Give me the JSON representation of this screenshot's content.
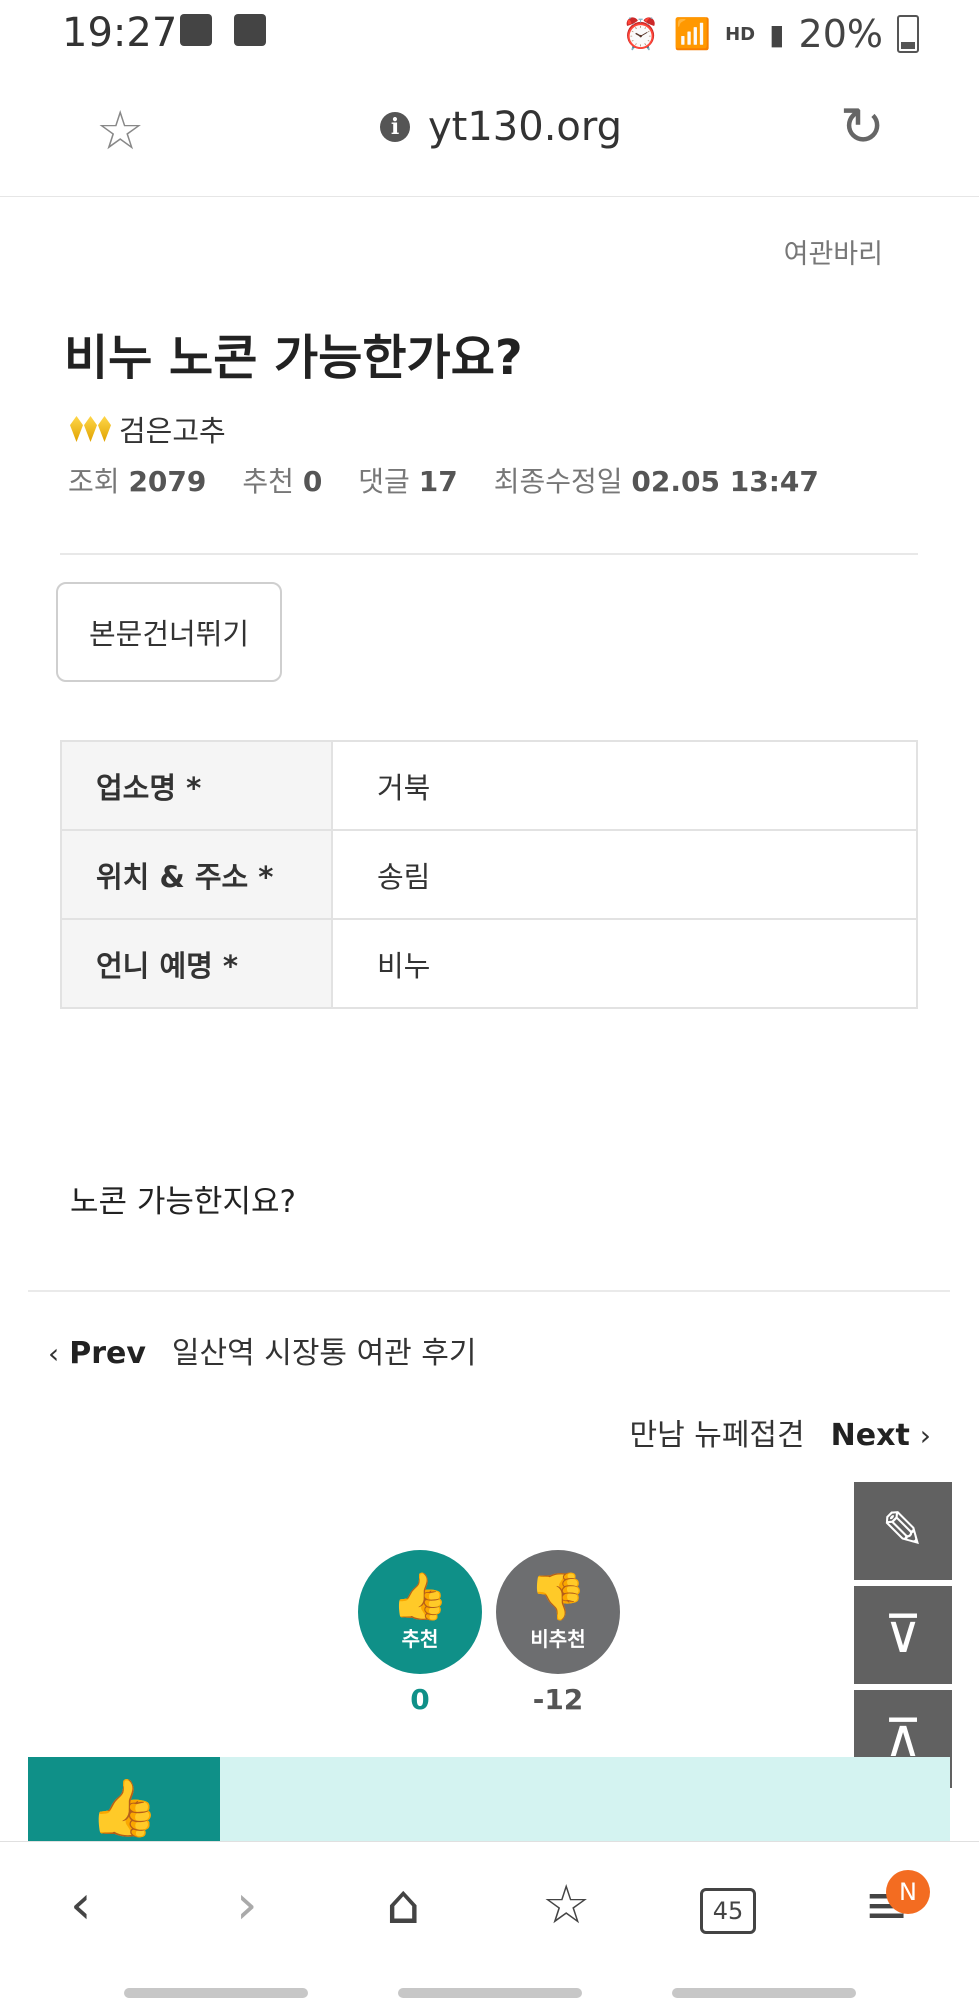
{
  "status_bar": {
    "time": "19:27",
    "battery": "20%",
    "icons": [
      "image-icon",
      "check-icon",
      "alarm-icon",
      "wifi-icon",
      "hd-voice-icon",
      "signal-icon",
      "battery-icon"
    ]
  },
  "browser": {
    "url": "yt130.org"
  },
  "post": {
    "category": "여관바리",
    "title": "비누 노콘 가능한가요?",
    "author": "검은고추",
    "meta": {
      "views_label": "조회",
      "views": "2079",
      "likes_label": "추천",
      "likes": "0",
      "comments_label": "댓글",
      "comments": "17",
      "modified_label": "최종수정일",
      "modified": "02.05 13:47"
    },
    "skip_button": "본문건너뛰기",
    "info_table": [
      {
        "label": "업소명 *",
        "value": "거북"
      },
      {
        "label": "위치 & 주소 *",
        "value": "송림"
      },
      {
        "label": "언니 예명 *",
        "value": "비누"
      }
    ],
    "body": "노콘 가능한지요?"
  },
  "navigation": {
    "prev_label": "Prev",
    "prev_title": "일산역 시장통 여관 후기",
    "next_label": "Next",
    "next_title": "만남 뉴페접견"
  },
  "votes": {
    "up_label": "추천",
    "up_count": "0",
    "down_label": "비추천",
    "down_count": "-12"
  },
  "bottom_nav": {
    "tabs_count": "45",
    "menu_badge": "N"
  },
  "colors": {
    "accent": "#0f9088",
    "downvote": "#6d6e70",
    "badge": "#f36c21"
  }
}
